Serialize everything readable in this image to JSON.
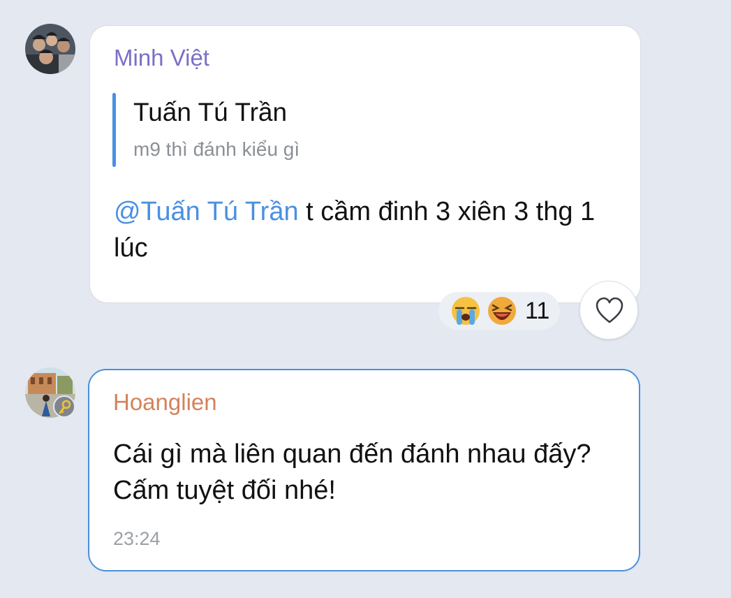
{
  "messages": [
    {
      "sender": "Minh Việt",
      "avatar_icon": "group-photo-avatar",
      "reply": {
        "author": "Tuấn Tú Trần",
        "text": "m9 thì đánh kiểu gì"
      },
      "mention": "@Tuấn Tú Trần",
      "text": " t cầm đinh 3 xiên 3 thg 1 lúc",
      "reactions": {
        "emojis": [
          "crying-face",
          "laughing-face"
        ],
        "count": "11"
      }
    },
    {
      "sender": "Hoanglien",
      "avatar_icon": "outdoor-photo-avatar",
      "badge_icon": "key-icon",
      "text": "Cái gì mà liên quan đến đánh nhau đấy? Cấm tuyệt đối nhé!",
      "time": "23:24"
    }
  ],
  "colors": {
    "background": "#e3e8f1",
    "accent": "#4a90e2",
    "sender_1": "#7a6fc6",
    "sender_2": "#d5825a"
  }
}
